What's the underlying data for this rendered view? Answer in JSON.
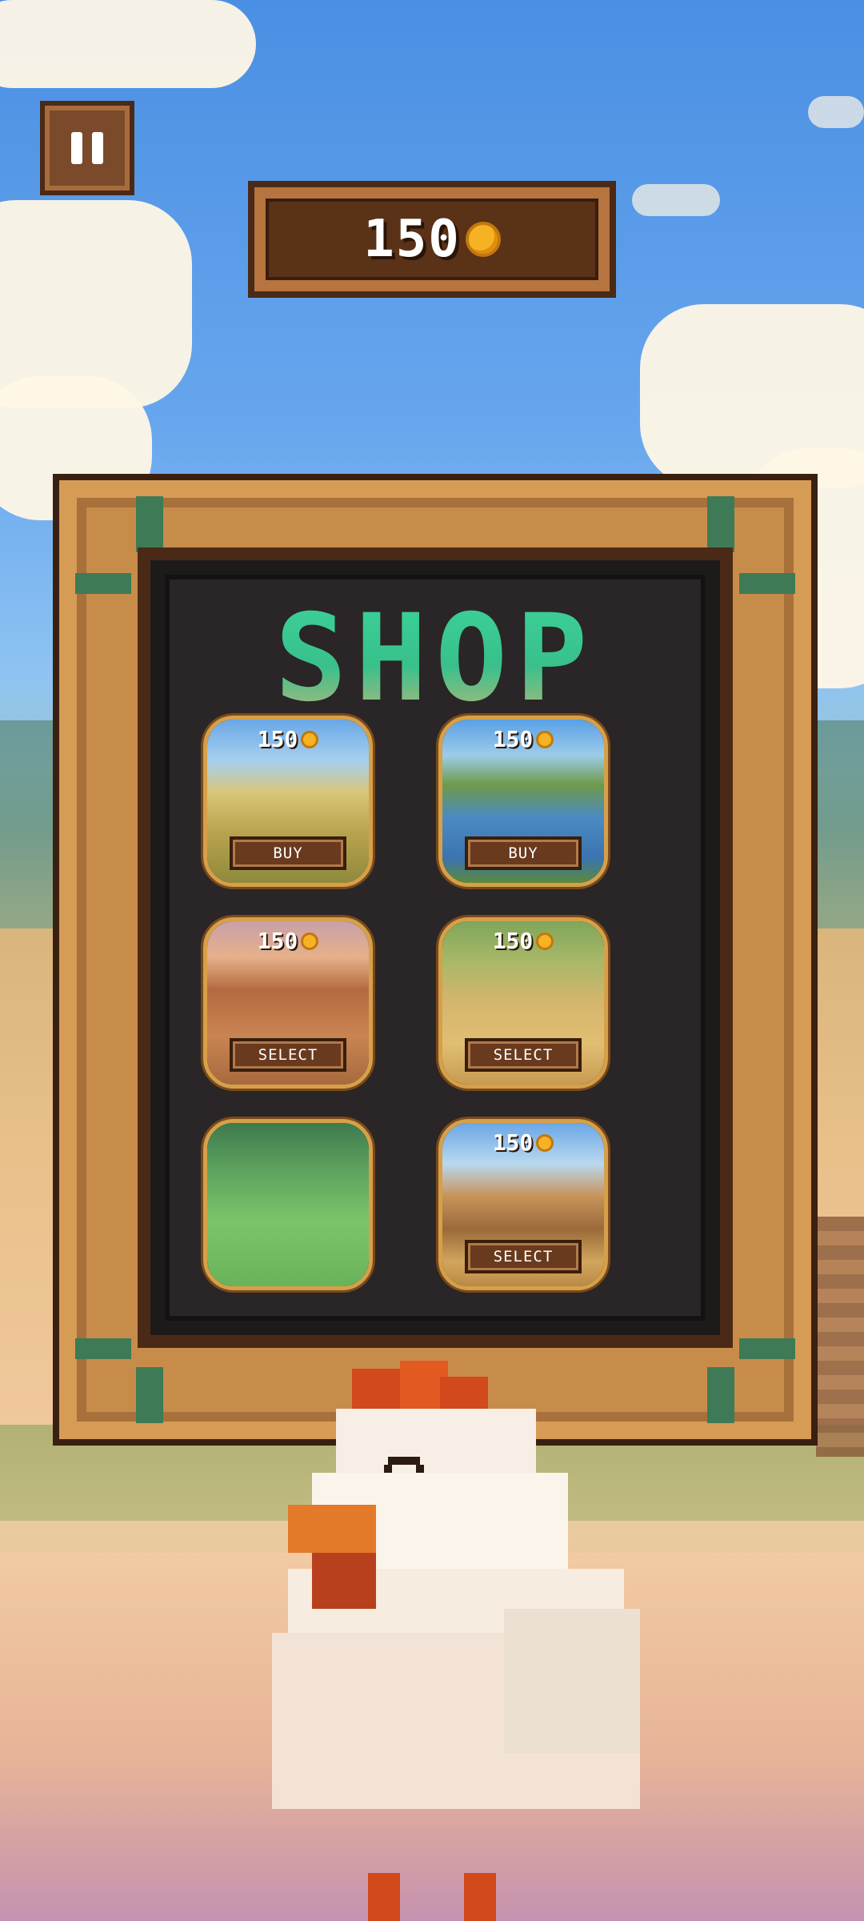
{
  "hud": {
    "coins": "150",
    "pause_icon": "pause-icon",
    "coin_icon": "coin-icon"
  },
  "shop": {
    "title": "SHOP",
    "items": [
      {
        "price": "150",
        "button": "BUY",
        "scene": "meadow-path"
      },
      {
        "price": "150",
        "button": "BUY",
        "scene": "pond-dock"
      },
      {
        "price": "150",
        "button": "SELECT",
        "scene": "campfire-clearing"
      },
      {
        "price": "150",
        "button": "SELECT",
        "scene": "fenced-yard"
      },
      {
        "price": "",
        "button": "",
        "scene": "grassy-field"
      },
      {
        "price": "150",
        "button": "SELECT",
        "scene": "wishing-well"
      }
    ]
  },
  "colors": {
    "sky": "#4a8fe3",
    "wood": "#c78c4a",
    "title_green": "#3ad49a",
    "coin": "#f5b324"
  }
}
